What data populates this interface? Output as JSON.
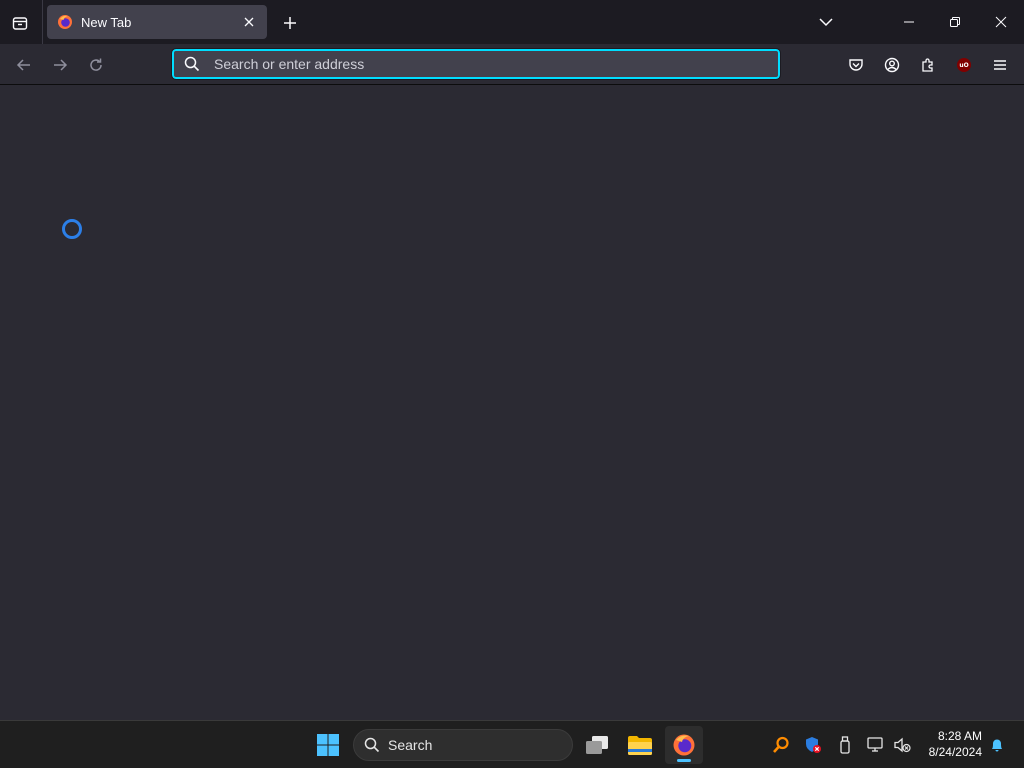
{
  "browser": {
    "tab": {
      "title": "New Tab",
      "favicon": "firefox-icon"
    },
    "urlbar": {
      "placeholder": "Search or enter address",
      "value": ""
    },
    "toolbar_icons": [
      "pocket-icon",
      "account-icon",
      "extensions-icon",
      "ublock-icon",
      "menu-icon"
    ],
    "ublock_label": "uO"
  },
  "taskbar": {
    "search_label": "Search",
    "time": "8:28 AM",
    "date": "8/24/2024"
  },
  "colors": {
    "accent": "#00ddff",
    "spinner": "#2c7fe8",
    "taskbar_active": "#4cc2ff"
  }
}
